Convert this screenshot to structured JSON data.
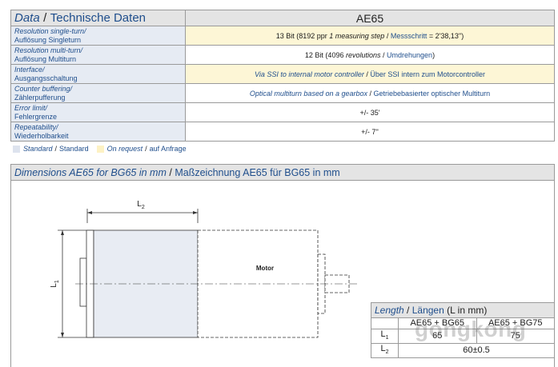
{
  "header": {
    "title_en": "Data",
    "title_sep": "/",
    "title_de": "Technische Daten",
    "model": "AE65"
  },
  "rows": [
    {
      "label_en": "Resolution single-turn/",
      "label_de": "Auflösung Singleturn",
      "value_pre": "13 Bit (8192 ppr ",
      "value_en": "1 measuring step",
      "value_sep": " / ",
      "value_de": "Messschritt",
      "value_post": " = 2'38,13'')",
      "bg": "yellow"
    },
    {
      "label_en": "Resolution multi-turn/",
      "label_de": "Auflösung Multiturn",
      "value_pre": "12 Bit (4096 ",
      "value_en": "revolutions",
      "value_sep": " / ",
      "value_de": "Umdrehungen",
      "value_post": ")",
      "bg": "white"
    },
    {
      "label_en": "Interface/",
      "label_de": "Ausgangsschaltung",
      "value_pre": "",
      "value_en": "Via SSI to internal motor controller",
      "value_sep": " / ",
      "value_de": "Über SSI intern zum Motorcontroller",
      "value_post": "",
      "bg": "yellow"
    },
    {
      "label_en": "Counter buffering/",
      "label_de": "Zählerpufferung",
      "value_pre": "",
      "value_en": "Optical multiturn based on a gearbox",
      "value_sep": " / ",
      "value_de": "Getriebebasierter optischer Multiturn",
      "value_post": "",
      "bg": "white"
    },
    {
      "label_en": "Error limit/",
      "label_de": "Fehlergrenze",
      "value_pre": "+/- 35'",
      "value_en": "",
      "value_sep": "",
      "value_de": "",
      "value_post": "",
      "bg": "white"
    },
    {
      "label_en": "Repeatability/",
      "label_de": "Wiederholbarkeit",
      "value_pre": "+/- 7''",
      "value_en": "",
      "value_sep": "",
      "value_de": "",
      "value_post": "",
      "bg": "white"
    }
  ],
  "legend": {
    "standard_en": "Standard",
    "sep": "/",
    "standard_de": "Standard",
    "request_en": "On request",
    "request_de": "auf Anfrage"
  },
  "dimensions": {
    "title_en": "Dimensions AE65 for BG65 in mm",
    "title_sep": "/",
    "title_de": "Maßzeichnung AE65 für BG65 in mm",
    "motor_label": "Motor",
    "l1_label": "L",
    "l1_sub": "1",
    "l2_label": "L",
    "l2_sub": "2"
  },
  "length_table": {
    "title_en": "Length",
    "title_sep": "/",
    "title_de": "Längen",
    "title_unit": "(L in mm)",
    "col1": "AE65 + BG65",
    "col2": "AE65 + BG75",
    "row1_sym": "L",
    "row1_sub": "1",
    "row1_v1": "65",
    "row1_v2": "75",
    "row2_sym": "L",
    "row2_sub": "2",
    "row2_v": "60±0.5"
  },
  "watermark": "gongkong",
  "colors": {
    "accent_blue": "#1f4e8c",
    "header_gray": "#e4e4e4",
    "label_blue_bg": "#e6ebf3",
    "request_yellow": "#fdf6d6"
  }
}
